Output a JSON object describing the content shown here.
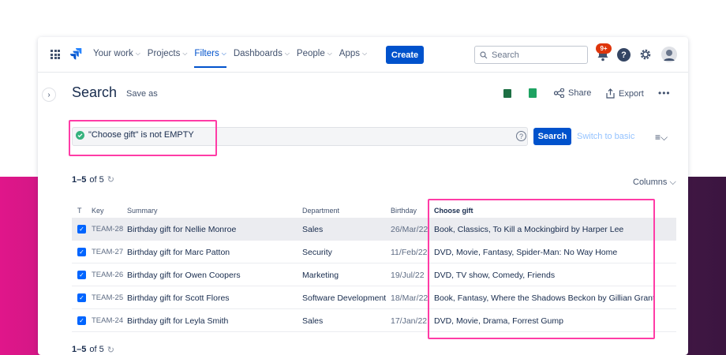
{
  "topnav": {
    "items": [
      {
        "label": "Your work",
        "caret": "⌵"
      },
      {
        "label": "Projects",
        "caret": "⌵"
      },
      {
        "label": "Filters",
        "caret": "⌵",
        "active": true
      },
      {
        "label": "Dashboards",
        "caret": "⌵"
      },
      {
        "label": "People",
        "caret": "⌵"
      },
      {
        "label": "Apps",
        "caret": "⌵"
      }
    ],
    "create_label": "Create",
    "search_placeholder": "Search",
    "notification_badge": "9+",
    "help_label": "?"
  },
  "page": {
    "title": "Search",
    "save_as": "Save as",
    "share_label": "Share",
    "export_label": "Export",
    "more": "•••"
  },
  "jql": {
    "query": "\"Choose gift\" is not EMPTY",
    "help": "?",
    "search_label": "Search",
    "switch_label": "Switch to basic",
    "menu": "≡⌵"
  },
  "results": {
    "count_range": "1–5",
    "count_of": "of 5",
    "columns_label": "Columns ⌵",
    "headers": {
      "type": "T",
      "key": "Key",
      "summary": "Summary",
      "department": "Department",
      "birthday": "Birthday",
      "gift": "Choose gift"
    },
    "rows": [
      {
        "key": "TEAM-28",
        "summary": "Birthday gift for Nellie Monroe",
        "department": "Sales",
        "birthday": "26/Mar/22",
        "gift": "Book, Classics, To Kill a Mockingbird by Harper Lee"
      },
      {
        "key": "TEAM-27",
        "summary": "Birthday gift for Marc Patton",
        "department": "Security",
        "birthday": "11/Feb/22",
        "gift": "DVD, Movie, Fantasy, Spider-Man: No Way Home"
      },
      {
        "key": "TEAM-26",
        "summary": "Birthday gift for Owen Coopers",
        "department": "Marketing",
        "birthday": "19/Jul/22",
        "gift": "DVD, TV show, Comedy, Friends"
      },
      {
        "key": "TEAM-25",
        "summary": "Birthday gift for Scott Flores",
        "department": "Software Development",
        "birthday": "18/Mar/22",
        "gift": "Book, Fantasy, Where the Shadows Beckon by Gillian Grant"
      },
      {
        "key": "TEAM-24",
        "summary": "Birthday gift for Leyla Smith",
        "department": "Sales",
        "birthday": "17/Jan/22",
        "gift": "DVD, Movie, Drama, Forrest Gump"
      }
    ],
    "row_more": "•••"
  },
  "colors": {
    "accent": "#0052cc",
    "highlight": "#ff3ca6",
    "success": "#36b37e"
  }
}
